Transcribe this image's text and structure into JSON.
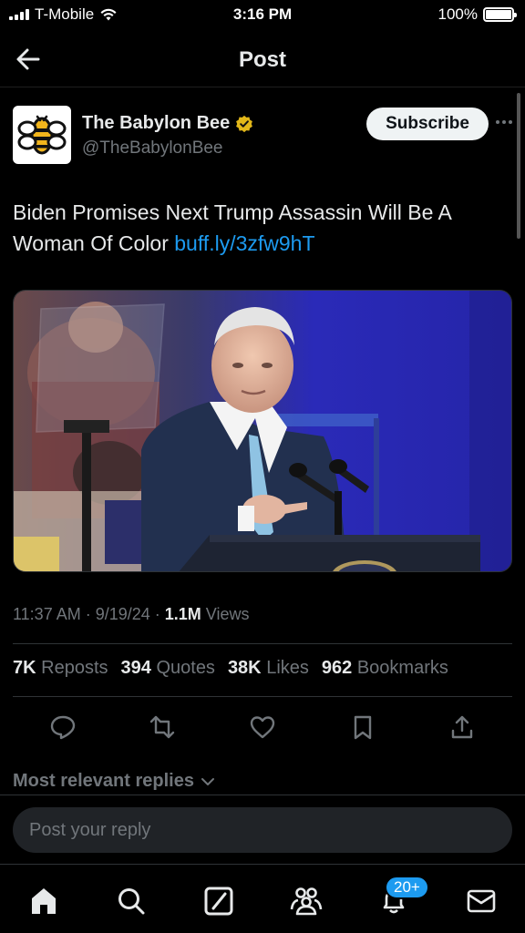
{
  "status_bar": {
    "carrier": "T-Mobile",
    "time": "3:16 PM",
    "battery": "100%"
  },
  "header": {
    "title": "Post"
  },
  "post": {
    "author_name": "The Babylon Bee",
    "author_handle": "@TheBabylonBee",
    "subscribe_label": "Subscribe",
    "text": "Biden Promises Next Trump Assassin Will Be A Woman Of Color",
    "link": "buff.ly/3zfw9hT",
    "meta_time_date": "11:37 AM · 9/19/24 · ",
    "meta_views_count": "1.1M",
    "meta_views_label": " Views"
  },
  "stats": [
    {
      "count": "7K",
      "label": "Reposts"
    },
    {
      "count": "394",
      "label": "Quotes"
    },
    {
      "count": "38K",
      "label": "Likes"
    },
    {
      "count": "962",
      "label": "Bookmarks"
    }
  ],
  "replies": {
    "sort_label": "Most relevant replies",
    "reply_placeholder": "Post your reply"
  },
  "bottom_nav": {
    "notifications_badge": "20+"
  },
  "icons": {
    "back": "back-arrow-icon",
    "verified": "verified-badge-icon",
    "more": "more-icon",
    "reply": "reply-icon",
    "repost": "repost-icon",
    "like": "heart-icon",
    "bookmark": "bookmark-icon",
    "share": "share-icon",
    "home": "home-icon",
    "search": "search-icon",
    "grok": "grok-icon",
    "communities": "communities-icon",
    "notifications": "bell-icon",
    "messages": "mail-icon"
  },
  "colors": {
    "link": "#1d9bf0",
    "verified": "#e2b719",
    "background": "#000000",
    "secondary_text": "#71767b"
  }
}
